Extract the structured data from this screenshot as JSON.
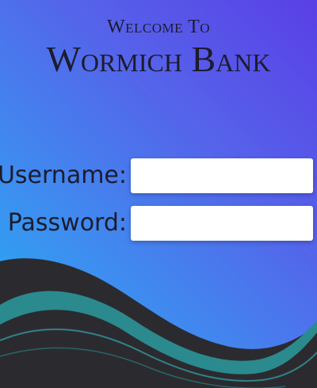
{
  "header": {
    "welcome": "Welcome To",
    "bank_name": "Wormich Bank"
  },
  "form": {
    "username_label": "Username:",
    "password_label": "Password:",
    "username_value": "",
    "password_value": ""
  },
  "colors": {
    "gradient_top_right": "#5a3fe6",
    "gradient_bottom_left": "#1fb2f2",
    "wave_dark": "#2b2b2f",
    "wave_teal": "#2a8a8e",
    "title_text": "#1c1c2e"
  }
}
